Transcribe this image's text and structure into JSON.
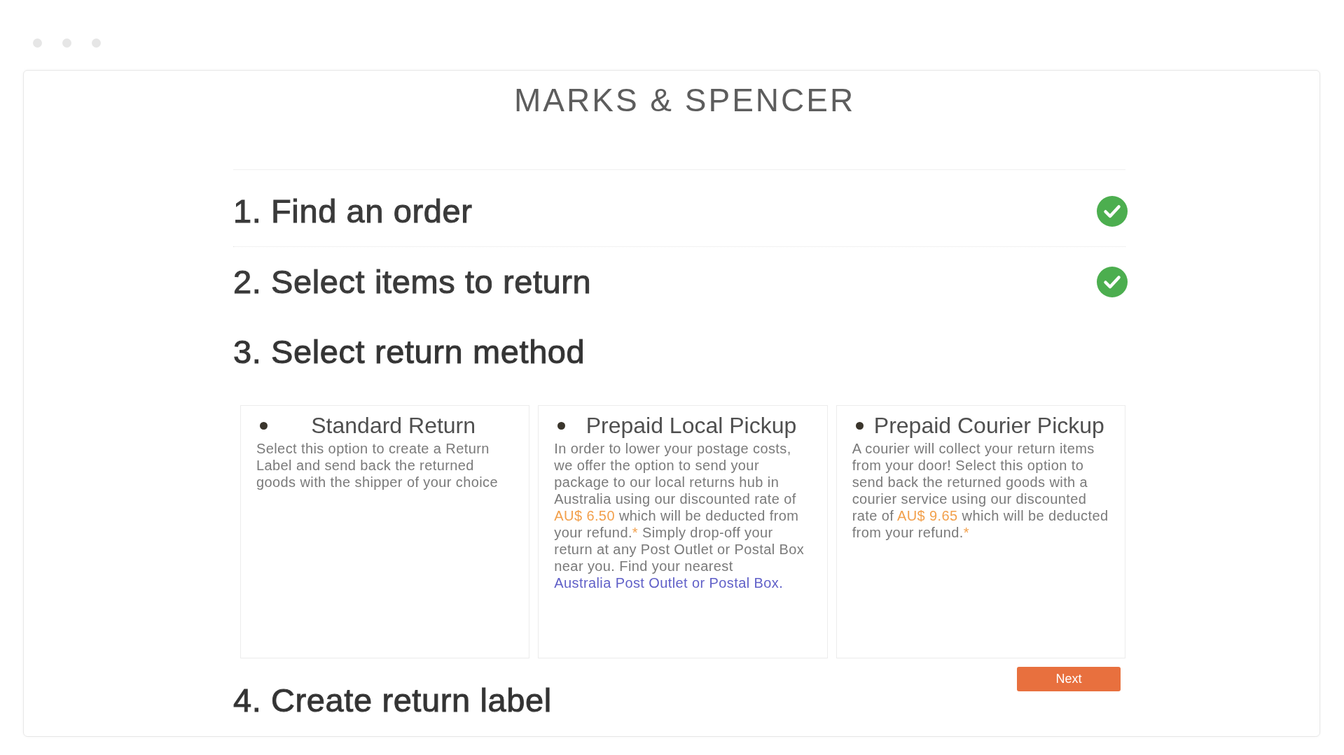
{
  "header": {
    "logo": "MARKS & SPENCER"
  },
  "steps": [
    {
      "label": "1. Find an order",
      "completed": true
    },
    {
      "label": "2. Select items to return",
      "completed": true
    },
    {
      "label": "3. Select return method",
      "completed": false,
      "return_methods": [
        {
          "title": "Standard Return",
          "selected": false,
          "description": [
            {
              "kind": "text",
              "text": "Select this option to create a Return Label and send back the returned goods with the shipper of your choice"
            }
          ]
        },
        {
          "title": "Prepaid Local Pickup",
          "selected": false,
          "description": [
            {
              "kind": "text",
              "text": "In order to lower your postage costs, we offer the option to send your package to our local returns hub in Australia using our discounted rate of "
            },
            {
              "kind": "highlight",
              "text": "AU$ 6.50"
            },
            {
              "kind": "text",
              "text": " which will be deducted from your refund."
            },
            {
              "kind": "highlight",
              "text": "*"
            },
            {
              "kind": "text",
              "text": " Simply drop-off your return at any Post Outlet or Postal Box near you. Find your nearest "
            },
            {
              "kind": "link",
              "text": "Australia Post Outlet or Postal Box."
            }
          ]
        },
        {
          "title": "Prepaid Courier Pickup",
          "selected": false,
          "description": [
            {
              "kind": "text",
              "text": "A courier will collect your return items from your door! Select this option to send back the returned goods with a courier service using our discounted rate of "
            },
            {
              "kind": "highlight",
              "text": "AU$ 9.65"
            },
            {
              "kind": "text",
              "text": " which will be deducted from your refund."
            },
            {
              "kind": "highlight",
              "text": "*"
            }
          ]
        }
      ],
      "next_button": "Next"
    },
    {
      "label": "4. Create return label",
      "completed": false
    }
  ]
}
